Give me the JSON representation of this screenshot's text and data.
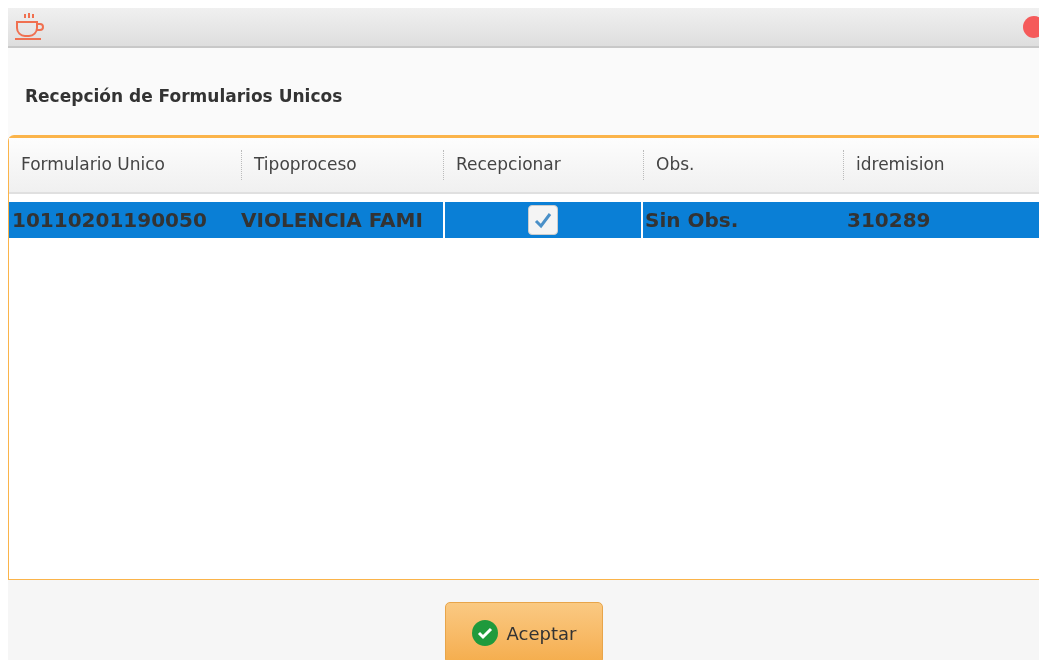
{
  "window": {
    "title": "Recepción de Formularios Unicos"
  },
  "table": {
    "columns": [
      "Formulario Unico",
      "Tipoproceso",
      "Recepcionar",
      "Obs.",
      "idremision"
    ],
    "rows": [
      {
        "selected": true,
        "formulario": "10110201190050",
        "tipoproceso": "VIOLENCIA FAMI",
        "recepcionar": true,
        "obs": "Sin Obs.",
        "idremision": "310289"
      }
    ]
  },
  "buttons": [
    {
      "label": "Aceptar"
    }
  ]
}
